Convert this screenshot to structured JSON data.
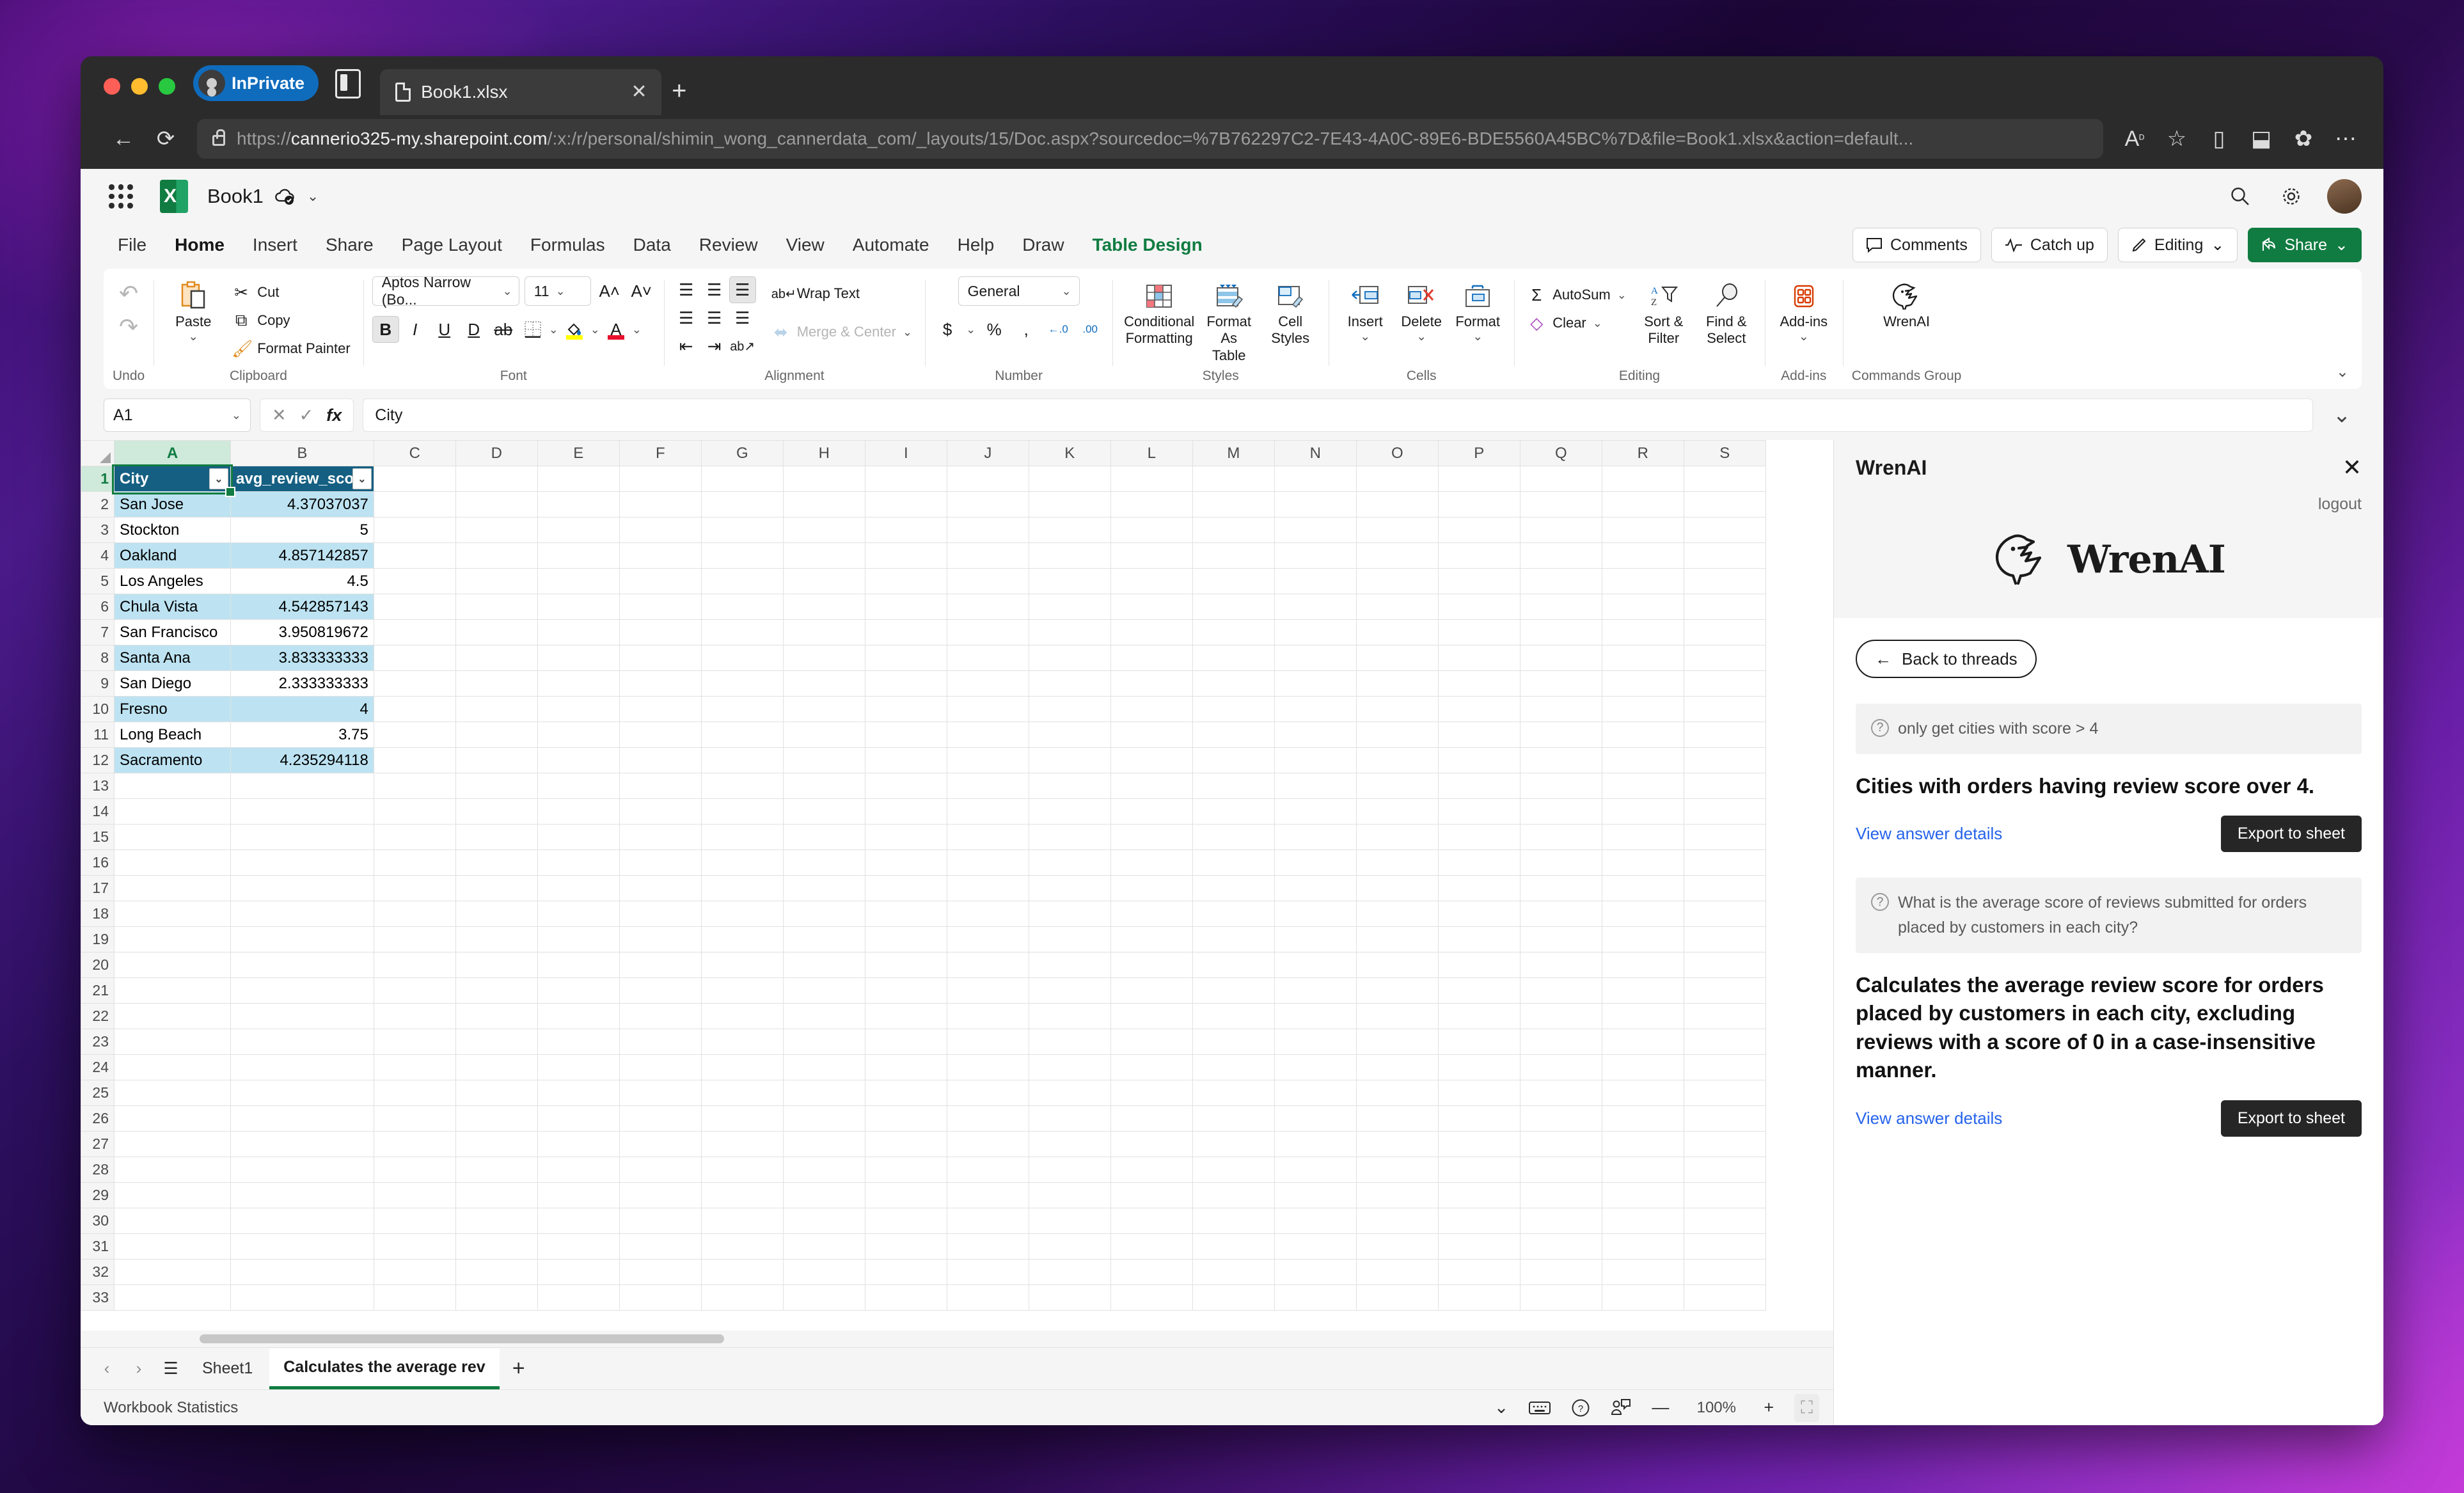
{
  "browser": {
    "profile_label": "InPrivate",
    "tab": {
      "title": "Book1.xlsx",
      "close_label": "✕"
    },
    "new_tab_label": "+",
    "back_label": "←",
    "reload_label": "⟳",
    "url_scheme": "https://",
    "url_host": "cannerio325-my.sharepoint.com",
    "url_path": "/:x:/r/personal/shimin_wong_cannerdata_com/_layouts/15/Doc.aspx?sourcedoc=%7B762297C2-7E43-4A0C-89E6-BDE5560A45BC%7D&file=Book1.xlsx&action=default...",
    "toolbar_icons": [
      "Aᴰ",
      "☆",
      "◫",
      "⇪",
      "✿",
      "⋯"
    ]
  },
  "excel": {
    "workbook_name": "Book1",
    "app_icon_letter": "X",
    "header_icons": [
      "search-icon",
      "gear-icon"
    ],
    "menu": [
      {
        "label": "File",
        "active": false
      },
      {
        "label": "Home",
        "active": true
      },
      {
        "label": "Insert",
        "active": false
      },
      {
        "label": "Share",
        "active": false
      },
      {
        "label": "Page Layout",
        "active": false
      },
      {
        "label": "Formulas",
        "active": false
      },
      {
        "label": "Data",
        "active": false
      },
      {
        "label": "Review",
        "active": false
      },
      {
        "label": "View",
        "active": false
      },
      {
        "label": "Automate",
        "active": false
      },
      {
        "label": "Help",
        "active": false
      },
      {
        "label": "Draw",
        "active": false
      },
      {
        "label": "Table Design",
        "active": false,
        "accent": true
      }
    ],
    "menu_right": [
      {
        "label": "Comments",
        "icon": "comment-icon"
      },
      {
        "label": "Catch up",
        "icon": "activity-icon"
      },
      {
        "label": "Editing",
        "icon": "pencil-icon",
        "caret": "⌄"
      },
      {
        "label": "Share",
        "icon": "share-icon",
        "caret": "⌄",
        "primary": true
      }
    ],
    "ribbon": {
      "undo": {
        "label": "Undo",
        "undo_icon": "↶",
        "redo_icon": "↷"
      },
      "clipboard": {
        "label": "Clipboard",
        "paste": "Paste",
        "cut": "Cut",
        "copy": "Copy",
        "format_painter": "Format Painter"
      },
      "font": {
        "label": "Font",
        "family": "Aptos Narrow (Bo...",
        "size": "11",
        "grow": "A˄",
        "shrink": "A˅",
        "bold": "B",
        "italic": "I",
        "underline": "U",
        "double_underline": "D",
        "strikethrough": "ab",
        "borders": "▦",
        "fill_color": "⬟",
        "font_color": "A"
      },
      "alignment": {
        "label": "Alignment",
        "wrap_text": "Wrap Text",
        "merge_center": "Merge & Center"
      },
      "number": {
        "label": "Number",
        "format": "General",
        "currency": "$",
        "percent": "%",
        "comma": ",",
        "inc_decimal": "←.0",
        "dec_decimal": ".00"
      },
      "styles": {
        "label": "Styles",
        "conditional_formatting": "Conditional\nFormatting",
        "format_as_table": "Format As\nTable",
        "cell_styles": "Cell\nStyles"
      },
      "cells": {
        "label": "Cells",
        "insert": "Insert",
        "delete": "Delete",
        "format": "Format"
      },
      "editing": {
        "label": "Editing",
        "autosum": "AutoSum",
        "clear": "Clear",
        "sort_filter": "Sort &\nFilter",
        "find_select": "Find &\nSelect"
      },
      "addins": {
        "label": "Add-ins",
        "button": "Add-ins"
      },
      "commands": {
        "label": "Commands Group",
        "button": "WrenAI"
      }
    },
    "formula_bar": {
      "name_box": "A1",
      "cancel": "✕",
      "confirm": "✓",
      "fx": "fx",
      "value": "City"
    },
    "grid": {
      "columns": [
        "A",
        "B",
        "C",
        "D",
        "E",
        "F",
        "G",
        "H",
        "I",
        "J",
        "K",
        "L",
        "M",
        "N",
        "O",
        "P",
        "Q",
        "R",
        "S"
      ],
      "selected_column": "A",
      "selected_row": 1,
      "table_headers": [
        "City",
        "avg_review_score"
      ],
      "rows": [
        {
          "n": 2,
          "city": "San Jose",
          "score": "4.37037037"
        },
        {
          "n": 3,
          "city": "Stockton",
          "score": "5"
        },
        {
          "n": 4,
          "city": "Oakland",
          "score": "4.857142857"
        },
        {
          "n": 5,
          "city": "Los Angeles",
          "score": "4.5"
        },
        {
          "n": 6,
          "city": "Chula Vista",
          "score": "4.542857143"
        },
        {
          "n": 7,
          "city": "San Francisco",
          "score": "3.950819672"
        },
        {
          "n": 8,
          "city": "Santa Ana",
          "score": "3.833333333"
        },
        {
          "n": 9,
          "city": "San Diego",
          "score": "2.333333333"
        },
        {
          "n": 10,
          "city": "Fresno",
          "score": "4"
        },
        {
          "n": 11,
          "city": "Long Beach",
          "score": "3.75"
        },
        {
          "n": 12,
          "city": "Sacramento",
          "score": "4.235294118"
        }
      ],
      "empty_rows": [
        13,
        14,
        15,
        16,
        17,
        18,
        19,
        20,
        21,
        22,
        23,
        24,
        25,
        26,
        27,
        28,
        29,
        30,
        31,
        32,
        33
      ]
    },
    "sheet_tabs": [
      {
        "label": "Sheet1",
        "active": false
      },
      {
        "label": "Calculates the average rev",
        "active": true
      }
    ],
    "sheet_add_label": "+",
    "status": {
      "left": "Workbook Statistics",
      "zoom": "100%",
      "zoom_out": "—",
      "zoom_in": "+"
    }
  },
  "wrenai": {
    "panel_title": "WrenAI",
    "close_label": "✕",
    "logout_label": "logout",
    "brand_name": "WrenAI",
    "back_button": "Back to threads",
    "back_arrow": "←",
    "threads": [
      {
        "question": "only get cities with score > 4",
        "answer": "Cities with orders having review score over 4.",
        "view_link": "View answer details",
        "export_button": "Export to sheet"
      },
      {
        "question": "What is the average score of reviews submitted for orders placed by customers in each city?",
        "answer": "Calculates the average review score for orders placed by customers in each city, excluding reviews with a score of 0 in a case-insensitive manner.",
        "view_link": "View answer details",
        "export_button": "Export to sheet"
      }
    ]
  },
  "colors": {
    "excel_green": "#107c41",
    "table_header_blue": "#156082",
    "table_band_blue": "#bde3f2",
    "link_blue": "#2563eb",
    "export_dark": "#262626",
    "inprivate_blue": "#0f6cbd"
  }
}
